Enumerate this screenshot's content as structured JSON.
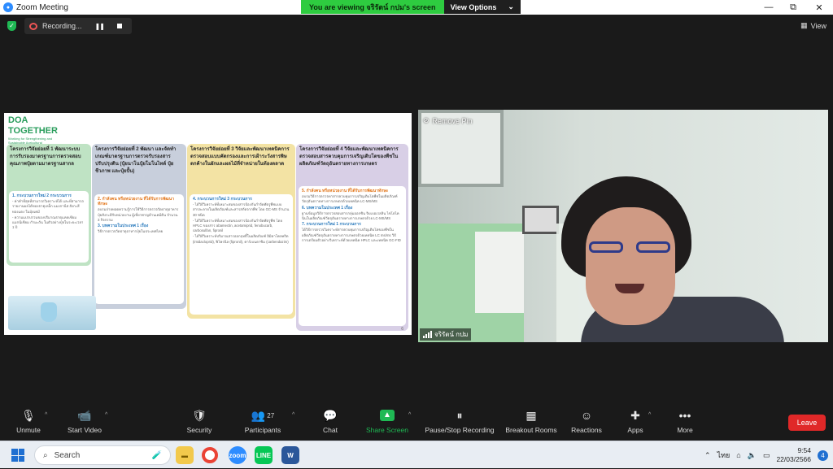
{
  "window": {
    "title": "Zoom Meeting",
    "controls": [
      "—",
      "⧉",
      "✕"
    ]
  },
  "share_banner": {
    "text": "You are viewing จริรัตน์ กปม's screen",
    "view_options": "View Options"
  },
  "topbar": {
    "recording_label": "Recording...",
    "view_label": "View"
  },
  "slide": {
    "logo_main": "DOA TOGETHER",
    "logo_sub": "Working for Strengthening and Sustainable Agricultural",
    "page_number": "6",
    "columns": [
      {
        "header": "โครงการวิจัยย่อยที่ 1 พัฒนาระบบการรับรองมาตรฐานการตรวจสอบคุณภาพปุ๋ยตามมาตรฐานสากล",
        "body": [
          "1. กระบวนการใหม่ 2 กระบวนการ",
          "- ค่าคำที่สุดที่สามารถวิเคราะห์ได้ และที่สามารถรายงานผลได้ของธาตุเหล็ก แมงกานีส สังกะสี ทองแดง ในปุ๋ยเคมี",
          "- ความแปรปรวนของปริมาณธาตุแคลเซียม แมกนีเซียม กำมะถัน ในตัวอย่างปุ๋ยในระยะเวลา 1 ปี"
        ]
      },
      {
        "header": "โครงการวิจัยย่อยที่ 2 พัฒนา และจัดทำเกณฑ์มาตรฐานการตรวจรับรองสารปรับปรุงดิน (ปุ๋ยนาโนปุ๋ยโมโนไทด์ ปุ๋ยชีวภาพ และปุ๋ยปั้น)",
        "body": [
          "2. กำลังคน หรือหน่วยงาน ที่ได้รับการพัฒนาทักษะ",
          "อบรมถ่ายทอดความรู้การใช้วิธีการตรวจวัดธาตุอาหารปุ๋ยสังกะสีกับหน่วยงาน ผู้เชี่ยวชาญด้านเคมีดิน จำนวน 3 กิจกรรม",
          "3. บทความในประเทศ 1 เรื่อง",
          "วิธีการตรวจวัดธาตุอาหารปุ๋ยในประเทศไทย"
        ]
      },
      {
        "header": "โครงการวิจัยย่อยที่ 3 วิจัยและพัฒนาเทคนิคการตรวจสอบแบบคัดกรองและการเฝ้าระวังสารพิษตกค้างในผักและผลไม้ที่จำหน่ายในท้องตลาด",
        "body": [
          "4. กระบวนการใหม่ 3 กระบวนการ",
          "- ได้วิธีวิเคราะห์ที่เหมาะสมของสารป้องกันกำจัดศัตรูพืชแบบสารละลายในผลิตภัณฑ์และสารสกัดจากพืช โดย GC-MS จำนวน 30 ชนิด",
          "- ได้วิธีวิเคราะห์ที่เหมาะสมของสารป้องกันกำจัดศัตรูพืช โดย HPLC ของสาร abamectin, acetamiprid, fenobucarb, carbosulfan, fipronil",
          "- ได้วิธีวิเคราะห์ปริมาณสารออกฤทธิ์ในผลิตภัณฑ์ อิมิดาโคลพริด (imidacloprid), ฟิโพรนิล (fipronil), คาร์เบนดาซิม (carbendazim)"
        ]
      },
      {
        "header": "โครงการวิจัยย่อยที่ 4 วิจัยและพัฒนาเทคนิคการตรวจสอบสารควบคุมการเจริญเติบโตของพืชในผลิตภัณฑ์วัตถุอันตรายทางการเกษตร",
        "body": [
          "5. กำลังคน หรือหน่วยงาน ที่ได้รับการพัฒนาทักษะ",
          "อบรมวิธีการตรวจหาสารควบคุมการเจริญเติบโตพืชในผลิตภัณฑ์วัตถุอันตรายทางการเกษตรด้วยเทคนิค LC-MS/MS",
          "6. บทความในประเทศ 1 เรื่อง",
          "ฐานข้อมูลวิธีการตรวจสอบสารกลุ่มออกซิน จิบเบอเรลลิน ไซโตไคนินในผลิตภัณฑ์วัตถุอันตรายทางการเกษตรด้วย LC-MS/MS",
          "7. กระบวนการใหม่ 1 กระบวนการ",
          "ได้วิธีการตรวจวิเคราะห์สารควบคุมการเจริญเติบโตของพืชในผลิตภัณฑ์วัตถุอันตรายทางการเกษตรด้วยเทคนิค LC ms/ms วิธีการเตรียมตัวอย่างวิเคราะห์ด้วยเทคนิค HPLC และเทคนิค GC-FID"
        ]
      }
    ]
  },
  "video": {
    "overlay": "Remove Pin",
    "participant_name": "จริรัตน์ กปม"
  },
  "toolbar": {
    "items": [
      {
        "icon": "🎙",
        "label": "Unmute"
      },
      {
        "icon": "📹",
        "label": "Start Video"
      },
      {
        "icon": "🛡",
        "label": "Security"
      },
      {
        "icon": "👥",
        "label": "Participants",
        "count": "27"
      },
      {
        "icon": "💬",
        "label": "Chat"
      },
      {
        "icon": "▲",
        "label": "Share Screen"
      },
      {
        "icon": "⏸",
        "label": "Pause/Stop Recording"
      },
      {
        "icon": "▦",
        "label": "Breakout Rooms"
      },
      {
        "icon": "☺",
        "label": "Reactions"
      },
      {
        "icon": "✚",
        "label": "Apps"
      },
      {
        "icon": "•••",
        "label": "More"
      }
    ],
    "leave": "Leave"
  },
  "taskbar": {
    "search_placeholder": "Search",
    "lang": "ไทย",
    "time": "9:54",
    "date": "22/03/2566",
    "notifications": "4"
  },
  "colors": {
    "accent": "#2d8cff",
    "share_green": "#1fb954",
    "leave_red": "#e02828"
  }
}
